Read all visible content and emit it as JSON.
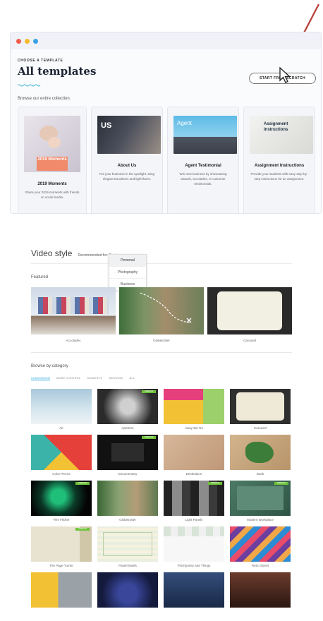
{
  "window": {
    "eyebrow": "CHOOSE A TEMPLATE",
    "title": "All templates",
    "browse_text": "Browse our entire collection.",
    "start_button": "START FROM SCRATCH",
    "cards": [
      {
        "title": "2019 Moments",
        "thumb_label": "2019 Moments",
        "desc": "Share your 2019 moments with friends on social media."
      },
      {
        "title": "About Us",
        "thumb_label": "US",
        "desc": "Put your business in the spotlight using elegant transitions and light flares."
      },
      {
        "title": "Agent Testimonial",
        "thumb_label": "Agent",
        "desc": "Win new business by showcasing awards, accolades, or customer testimonials."
      },
      {
        "title": "Assignment Instructions",
        "thumb_label": "Assignment Instructions",
        "desc": "Provide your students with easy step-by-step instructions for an assignment."
      }
    ]
  },
  "video_style": {
    "title": "Video style",
    "subtitle": "Recommended for: Business",
    "dropdown": [
      "Personal",
      "Photography",
      "Business"
    ],
    "featured_label": "Featured",
    "featured": [
      "Accolades",
      "Globetrotter",
      "Carousel"
    ],
    "browse_label": "Browse by category",
    "category_tabs": [
      "CLASSROOM",
      "MORE CONTROL",
      "MOMENTS",
      "WEDDING",
      "ALL"
    ],
    "badge_text": "PREMIUM",
    "grid": [
      "Air",
      "Aperture",
      "Away We Go",
      "Carousel",
      "Color Pieces",
      "Documentary",
      "Destination",
      "Dash",
      "Film Flicker",
      "Globetrotter",
      "Light Panels",
      "Modern Workplace",
      "The Page Turner",
      "Pastel Motifs",
      "Pinchpointy and Things",
      "Retro Street",
      "",
      "",
      "",
      ""
    ]
  }
}
